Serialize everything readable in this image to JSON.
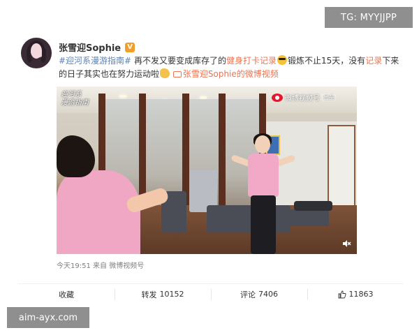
{
  "watermarks": {
    "top_right": "TG: MYYJJPP",
    "bottom_left": "aim-ayx.com"
  },
  "post": {
    "author": "张雪迎Sophie",
    "verified_icon": "verified-badge-icon",
    "text": {
      "topic": "#迎河系漫游指南#",
      "part1": " 再不发又要变成库存了的",
      "link1": "健身打卡记录",
      "emoji1": "sunglasses-emoji",
      "part2": "锻炼不止15天，没有",
      "link2": "记录",
      "part3": "下来的日子其实也在努力运动啦",
      "emoji2": "muscle-emoji",
      "video_link": "张雪迎Sophie的微博视频"
    },
    "video": {
      "caption_line1": "迎河系",
      "caption_line2": "漫游指南",
      "source_logo": "微博视频号",
      "source_tag": "出品"
    },
    "meta": {
      "time": "今天19:51",
      "source": "来自 微博视频号"
    },
    "actions": {
      "favorite": "收藏",
      "repost_label": "转发",
      "repost_count": "10152",
      "comment_label": "评论",
      "comment_count": "7406",
      "like_count": "11863"
    }
  },
  "colors": {
    "link": "#eb7350",
    "topic": "#5e82b4",
    "watermark_bg": "#8f8f8f"
  }
}
